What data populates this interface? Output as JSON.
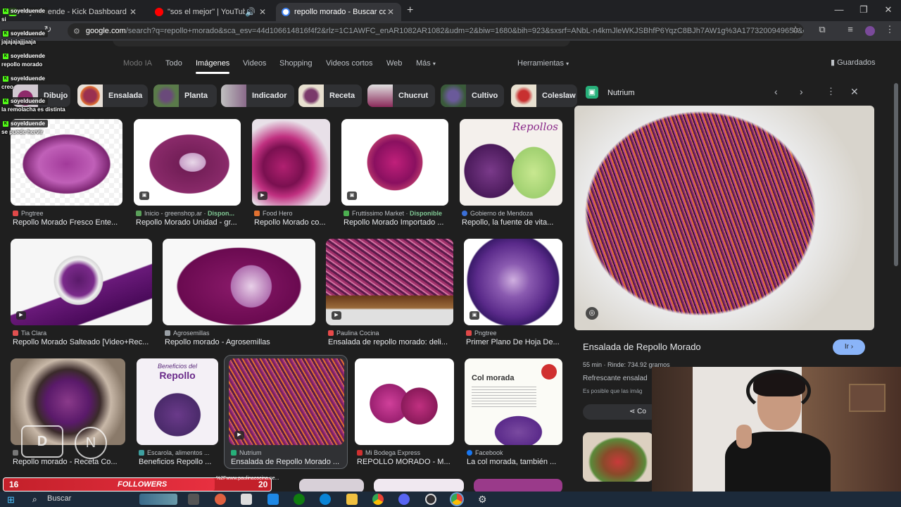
{
  "tabs": [
    {
      "title": "soyelduende - Kick Dashboard"
    },
    {
      "title": "\"sos el mejor\" | YouTube M"
    },
    {
      "title": "repollo morado - Buscar con G"
    }
  ],
  "address": {
    "domain": "google.com",
    "path": "/search?q=repollo+morado&sca_esv=44d106614816f4f2&rlz=1C1AWFC_enAR1082AR1082&udm=2&biw=1680&bih=923&sxsrf=ANbL-n4kmJleWKJSBhfP6YqzC8BJh7AW1g%3A1773200949650&ei..."
  },
  "nav": {
    "tabs": [
      "Modo IA",
      "Todo",
      "Imágenes",
      "Videos",
      "Shopping",
      "Videos cortos",
      "Web",
      "Más"
    ],
    "tools": "Herramientas",
    "saved": "Guardados"
  },
  "chips": [
    "Dibujo",
    "Ensalada",
    "Planta",
    "Indicador",
    "Receta",
    "Chucrut",
    "Cultivo",
    "Coleslaw"
  ],
  "results": [
    {
      "source": "Pngtree",
      "disp": "",
      "title": "Repollo Morado Fresco Ente...",
      "color": "#e04848"
    },
    {
      "source": "Inicio - greenshop.ar",
      "disp": "Dispon...",
      "title": "Repollo Morado Unidad - gr...",
      "color": "#5aa05a"
    },
    {
      "source": "Food Hero",
      "disp": "",
      "title": "Repollo Morado co...",
      "color": "#e07030"
    },
    {
      "source": "Fruttissimo Market",
      "disp": "Disponible",
      "title": "Repollo Morado Importado ...",
      "color": "#4caf50"
    },
    {
      "source": "Gobierno de Mendoza",
      "disp": "",
      "title": "Repollo, la fuente de vita...",
      "color": "#3b6fd6"
    },
    {
      "source": "Tia Clara",
      "disp": "",
      "title": "Repollo Morado Salteado [Video+Rec...",
      "color": "#e05050"
    },
    {
      "source": "Agrosemillas",
      "disp": "",
      "title": "Repollo morado - Agrosemillas",
      "color": "#9aa0a6"
    },
    {
      "source": "Paulina Cocina",
      "disp": "",
      "title": "Ensalada de repollo morado: deli...",
      "color": "#e84a4a"
    },
    {
      "source": "Pngtree",
      "disp": "",
      "title": "Primer Plano De Hoja De...",
      "color": "#e04848"
    },
    {
      "source": "",
      "disp": "",
      "title": "Repollo morado - Receta Co...",
      "color": "#777777"
    },
    {
      "source": "Escarola, alimentos ...",
      "disp": "",
      "title": "Beneficios Repollo ...",
      "color": "#3ea0a0"
    },
    {
      "source": "Nutrium",
      "disp": "",
      "title": "Ensalada de Repollo Morado ...",
      "color": "#27b07a"
    },
    {
      "source": "Mi Bodega Express",
      "disp": "",
      "title": "REPOLLO MORADO - M...",
      "color": "#d03030"
    },
    {
      "source": "Facebook",
      "disp": "",
      "title": "La col morada, también ...",
      "color": "#1877f2"
    }
  ],
  "thumb_text": {
    "repollos": "Repollos",
    "beneficios": "Beneficios del",
    "beneficios2": "Repollo",
    "col": "Col morada"
  },
  "panel": {
    "source": "Nutrium",
    "title": "Ensalada de Repollo Morado",
    "ir": "Ir",
    "meta_time": "55 min",
    "meta_yield": "Rinde: 734.92 gramos",
    "desc": "Refrescante ensalad",
    "notice": "Es posible que las imág",
    "share": "Co"
  },
  "chat": [
    {
      "user": "soyelduende",
      "msg": "si"
    },
    {
      "user": "soyelduende",
      "msg": "jajajajajjjaaja"
    },
    {
      "user": "soyelduende",
      "msg": "repollo morado"
    },
    {
      "user": "soyelduende",
      "msg": "creo"
    },
    {
      "user": "soyelduende",
      "msg": "la remolacha es distinta"
    },
    {
      "user": "soyelduende",
      "msg": "se puede hervir"
    }
  ],
  "followers": {
    "label": "FOLLOWERS",
    "left": "16",
    "right": "20",
    "ticker": "%2Fwww.paulinacocina.ne..."
  },
  "taskbar": {
    "search": "Buscar"
  }
}
